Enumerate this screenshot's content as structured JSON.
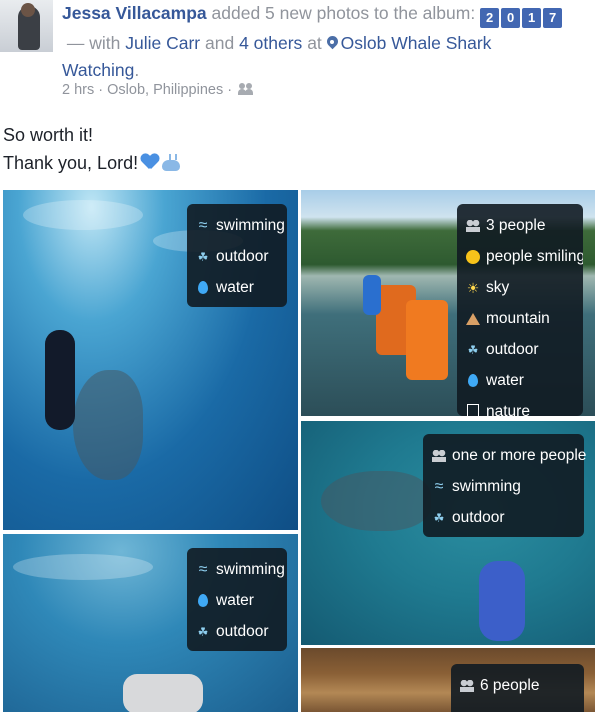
{
  "post": {
    "author": "Jessa Villacampa",
    "action_text": "added 5 new photos to the album:",
    "album_tiles": [
      "2",
      "0",
      "1",
      "7"
    ],
    "with_prefix": "— with",
    "tagged_person": "Julie Carr",
    "and_text": "and",
    "others_link": "4 others",
    "at_text": "at",
    "place": "Oslob Whale Shark",
    "place_line2": "Watching",
    "period": ".",
    "time": "2 hrs",
    "separator": "·",
    "location": "Oslob, Philippines",
    "audience_icon": "friends-icon",
    "status_line1": "So worth it!",
    "status_line2": "Thank you, Lord!",
    "status_emoji": [
      "blue-heart",
      "whale"
    ]
  },
  "photos": [
    {
      "name": "photo-1",
      "tags": [
        {
          "icon": "swimming-icon",
          "label": "swimming"
        },
        {
          "icon": "outdoor-icon",
          "label": "outdoor"
        },
        {
          "icon": "water-icon",
          "label": "water"
        }
      ]
    },
    {
      "name": "photo-2",
      "tags": [
        {
          "icon": "people-icon",
          "label": "3 people"
        },
        {
          "icon": "smiling-icon",
          "label": "people smiling"
        },
        {
          "icon": "sky-icon",
          "label": "sky"
        },
        {
          "icon": "mountain-icon",
          "label": "mountain"
        },
        {
          "icon": "outdoor-icon",
          "label": "outdoor"
        },
        {
          "icon": "water-icon",
          "label": "water"
        },
        {
          "icon": "nature-icon",
          "label": "nature"
        }
      ]
    },
    {
      "name": "photo-3",
      "tags": [
        {
          "icon": "people-icon",
          "label": "one or more people"
        },
        {
          "icon": "swimming-icon",
          "label": "swimming"
        },
        {
          "icon": "outdoor-icon",
          "label": "outdoor"
        }
      ]
    },
    {
      "name": "photo-4",
      "tags": [
        {
          "icon": "swimming-icon",
          "label": "swimming"
        },
        {
          "icon": "water-icon",
          "label": "water"
        },
        {
          "icon": "outdoor-icon",
          "label": "outdoor"
        }
      ]
    },
    {
      "name": "photo-5",
      "tags": [
        {
          "icon": "people-icon",
          "label": "6 people"
        }
      ]
    }
  ]
}
